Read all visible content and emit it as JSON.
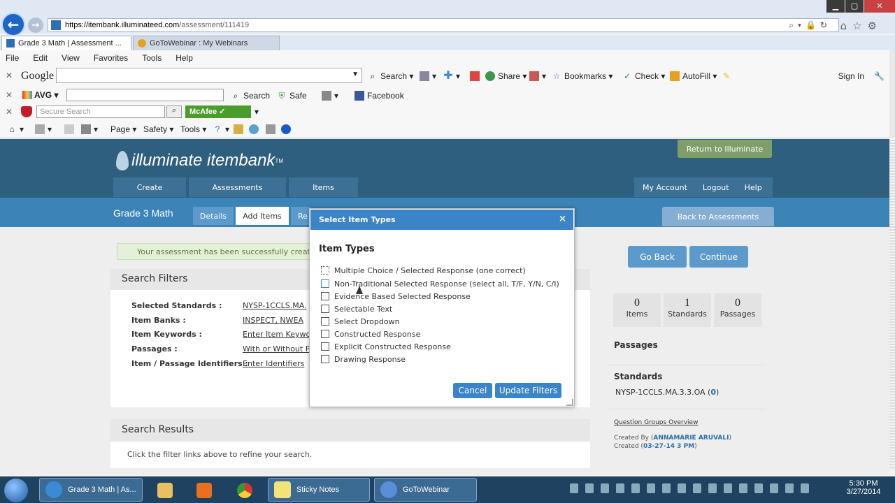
{
  "browser": {
    "url_host": "https://itembank.illuminateed.com",
    "url_path": "/assessment/111419",
    "tabs": [
      {
        "label": "Grade 3 Math | Assessment ..."
      },
      {
        "label": "GoToWebinar : My Webinars"
      }
    ],
    "menu": [
      "File",
      "Edit",
      "View",
      "Favorites",
      "Tools",
      "Help"
    ],
    "google_toolbar": {
      "logo": "Google",
      "search": "Search",
      "share": "Share",
      "bookmarks": "Bookmarks",
      "check": "Check",
      "autofill": "AutoFill",
      "sign_in": "Sign In"
    },
    "avg_toolbar": {
      "logo": "AVG",
      "search": "Search",
      "safe": "Safe",
      "facebook": "Facebook"
    },
    "mcafee_toolbar": {
      "placeholder": "Secure Search",
      "badge": "McAfee"
    },
    "command_bar": {
      "page": "Page",
      "safety": "Safety",
      "tools": "Tools"
    }
  },
  "app": {
    "logo": "illuminate itembank",
    "logo_mark": "TM",
    "return_button": "Return to Illuminate",
    "nav": {
      "create": "Create",
      "assessments": "Assessments",
      "items": "Items"
    },
    "user_nav": {
      "account": "My Account",
      "logout": "Logout",
      "help": "Help"
    },
    "page_title": "Grade 3 Math",
    "subtabs": {
      "details": "Details",
      "add_items": "Add Items",
      "rep": "Re"
    },
    "back_to_assessments": "Back to Assessments",
    "alert": "Your assessment has been successfully creat",
    "filters": {
      "title": "Search Filters",
      "rows": [
        {
          "label": "Selected Standards :",
          "value": "NYSP-1CCLS.MA."
        },
        {
          "label": "Item Banks :",
          "value": "INSPECT, NWEA"
        },
        {
          "label": "Item Keywords :",
          "value": "Enter Item Keywo"
        },
        {
          "label": "Passages :",
          "value": "With or Without P"
        },
        {
          "label": "Item / Passage Identifiers :",
          "value": "Enter Identifiers"
        }
      ]
    },
    "results": {
      "title": "Search Results",
      "hint": "Click the filter links above to refine your search."
    },
    "actions": {
      "go_back": "Go Back",
      "continue": "Continue"
    },
    "stats": [
      {
        "num": "0",
        "label": "Items"
      },
      {
        "num": "1",
        "label": "Standards"
      },
      {
        "num": "0",
        "label": "Passages"
      }
    ],
    "sidebar": {
      "passages": "Passages",
      "standards": "Standards",
      "standard_code": "NYSP-1CCLS.MA.3.3.OA",
      "standard_count": "0",
      "question_groups": "Question Groups Overview",
      "created_by_label": "Created By",
      "created_by": "ANNAMARIE ARUVALI",
      "created_label": "Created",
      "created": "03-27-14 3 PM"
    }
  },
  "modal": {
    "title": "Select Item Types",
    "close": "×",
    "subtitle": "Item Types",
    "options": [
      {
        "label": "Multiple Choice / Selected Response (one correct)"
      },
      {
        "label": "Non-Traditional Selected Response (select all, T/F, Y/N, C/I)"
      },
      {
        "label": "Evidence Based Selected Response"
      },
      {
        "label": "Selectable Text"
      },
      {
        "label": "Select Dropdown"
      },
      {
        "label": "Constructed Response"
      },
      {
        "label": "Explicit Constructed Response"
      },
      {
        "label": "Drawing Response"
      }
    ],
    "cancel": "Cancel",
    "update": "Update Filters"
  },
  "taskbar": {
    "tasks": [
      {
        "label": "Grade 3 Math | As..."
      },
      {
        "label": "Sticky Notes"
      },
      {
        "label": "GoToWebinar"
      }
    ],
    "time": "5:30 PM",
    "date": "3/27/2014"
  },
  "colors": {
    "header": "#2e5f7f",
    "subheader": "#3c84b8",
    "modal_head": "#3c84c8",
    "return_btn": "#7f9e69"
  }
}
